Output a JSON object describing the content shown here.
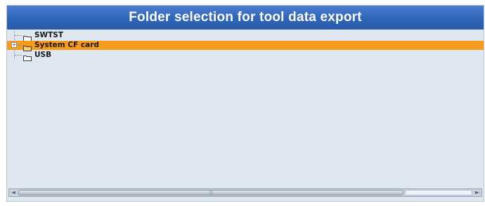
{
  "dialog": {
    "title": "Folder selection for tool data export"
  },
  "tree": {
    "items": [
      {
        "label": "SWTST",
        "icon": "folder-icon",
        "expandable": false,
        "selected": false
      },
      {
        "label": "System CF card",
        "icon": "folder-icon",
        "expandable": true,
        "expander_symbol": "+",
        "selected": true
      },
      {
        "label": "USB",
        "icon": "folder-icon",
        "expandable": false,
        "selected": false
      }
    ]
  },
  "scrollbar": {
    "left_arrow": "◄",
    "right_arrow": "►",
    "grip": "|||"
  },
  "colors": {
    "title_bar": "#2f64b8",
    "selection": "#f89a1c",
    "background": "#dfe7f1"
  }
}
